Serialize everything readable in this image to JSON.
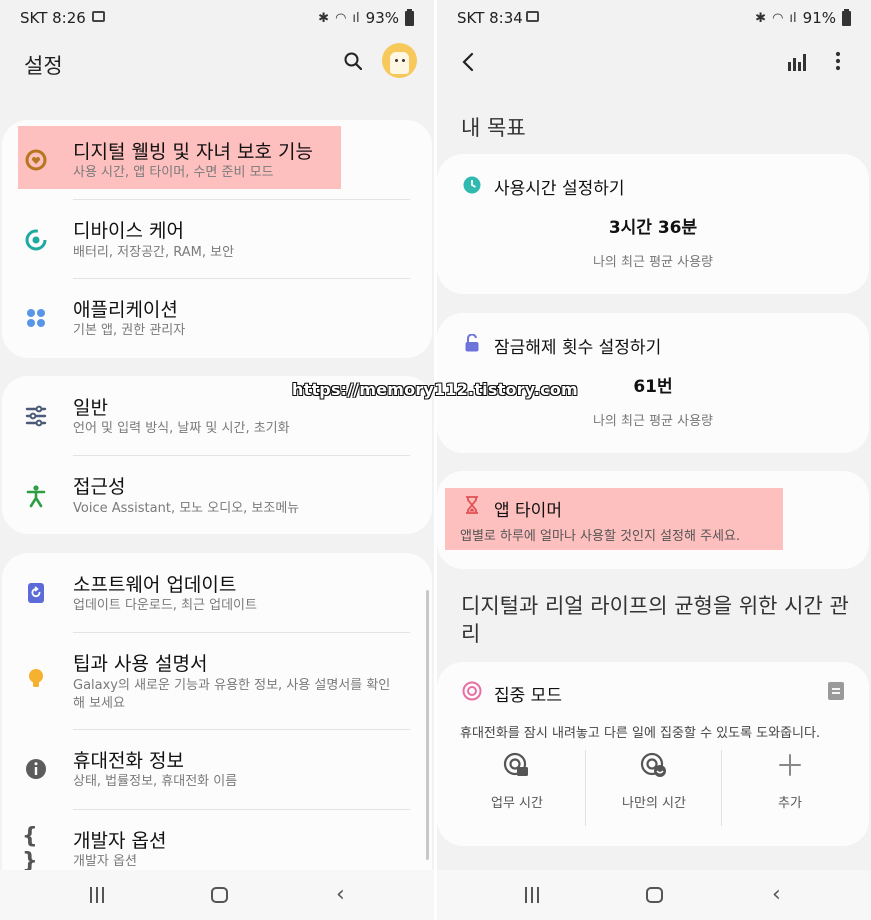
{
  "left": {
    "status": {
      "carrier_time": "SKT 8:26",
      "battery": "93%"
    },
    "header": {
      "title": "설정"
    },
    "items": [
      {
        "title": "디지털 웰빙 및 자녀 보호 기능",
        "subtitle": "사용 시간, 앱 타이머, 수면 준비 모드"
      },
      {
        "title": "디바이스 케어",
        "subtitle": "배터리, 저장공간, RAM, 보안"
      },
      {
        "title": "애플리케이션",
        "subtitle": "기본 앱, 권한 관리자"
      },
      {
        "title": "일반",
        "subtitle": "언어 및 입력 방식, 날짜 및 시간, 초기화"
      },
      {
        "title": "접근성",
        "subtitle": "Voice Assistant, 모노 오디오, 보조메뉴"
      },
      {
        "title": "소프트웨어 업데이트",
        "subtitle": "업데이트 다운로드, 최근 업데이트"
      },
      {
        "title": "팁과 사용 설명서",
        "subtitle": "Galaxy의 새로운 기능과 유용한 정보, 사용 설명서를 확인해 보세요"
      },
      {
        "title": "휴대전화 정보",
        "subtitle": "상태, 법률정보, 휴대전화 이름"
      },
      {
        "title": "개발자 옵션",
        "subtitle": "개발자 옵션"
      }
    ]
  },
  "right": {
    "status": {
      "carrier_time": "SKT 8:34",
      "battery": "91%"
    },
    "my_goals_title": "내 목표",
    "goal_screen_time": {
      "label": "사용시간 설정하기",
      "value": "3시간 36분",
      "caption": "나의 최근 평균 사용량"
    },
    "goal_unlocks": {
      "label": "잠금해제 횟수 설정하기",
      "value": "61번",
      "caption": "나의 최근 평균 사용량"
    },
    "app_timer": {
      "label": "앱 타이머",
      "description": "앱별로 하루에 얼마나 사용할 것인지 설정해 주세요."
    },
    "balance_title": "디지털과 리얼 라이프의 균형을 위한 시간 관리",
    "focus_mode": {
      "label": "집중 모드",
      "description": "휴대전화를 잠시 내려놓고 다른 일에 집중할 수 있도록 도와줍니다.",
      "buttons": [
        "업무 시간",
        "나만의 시간",
        "추가"
      ]
    }
  },
  "watermark": "https://memory112.tistory.com",
  "colors": {
    "highlight": "#ff8c8c",
    "teal": "#2fb9b0",
    "accent_red": "#e05353"
  }
}
